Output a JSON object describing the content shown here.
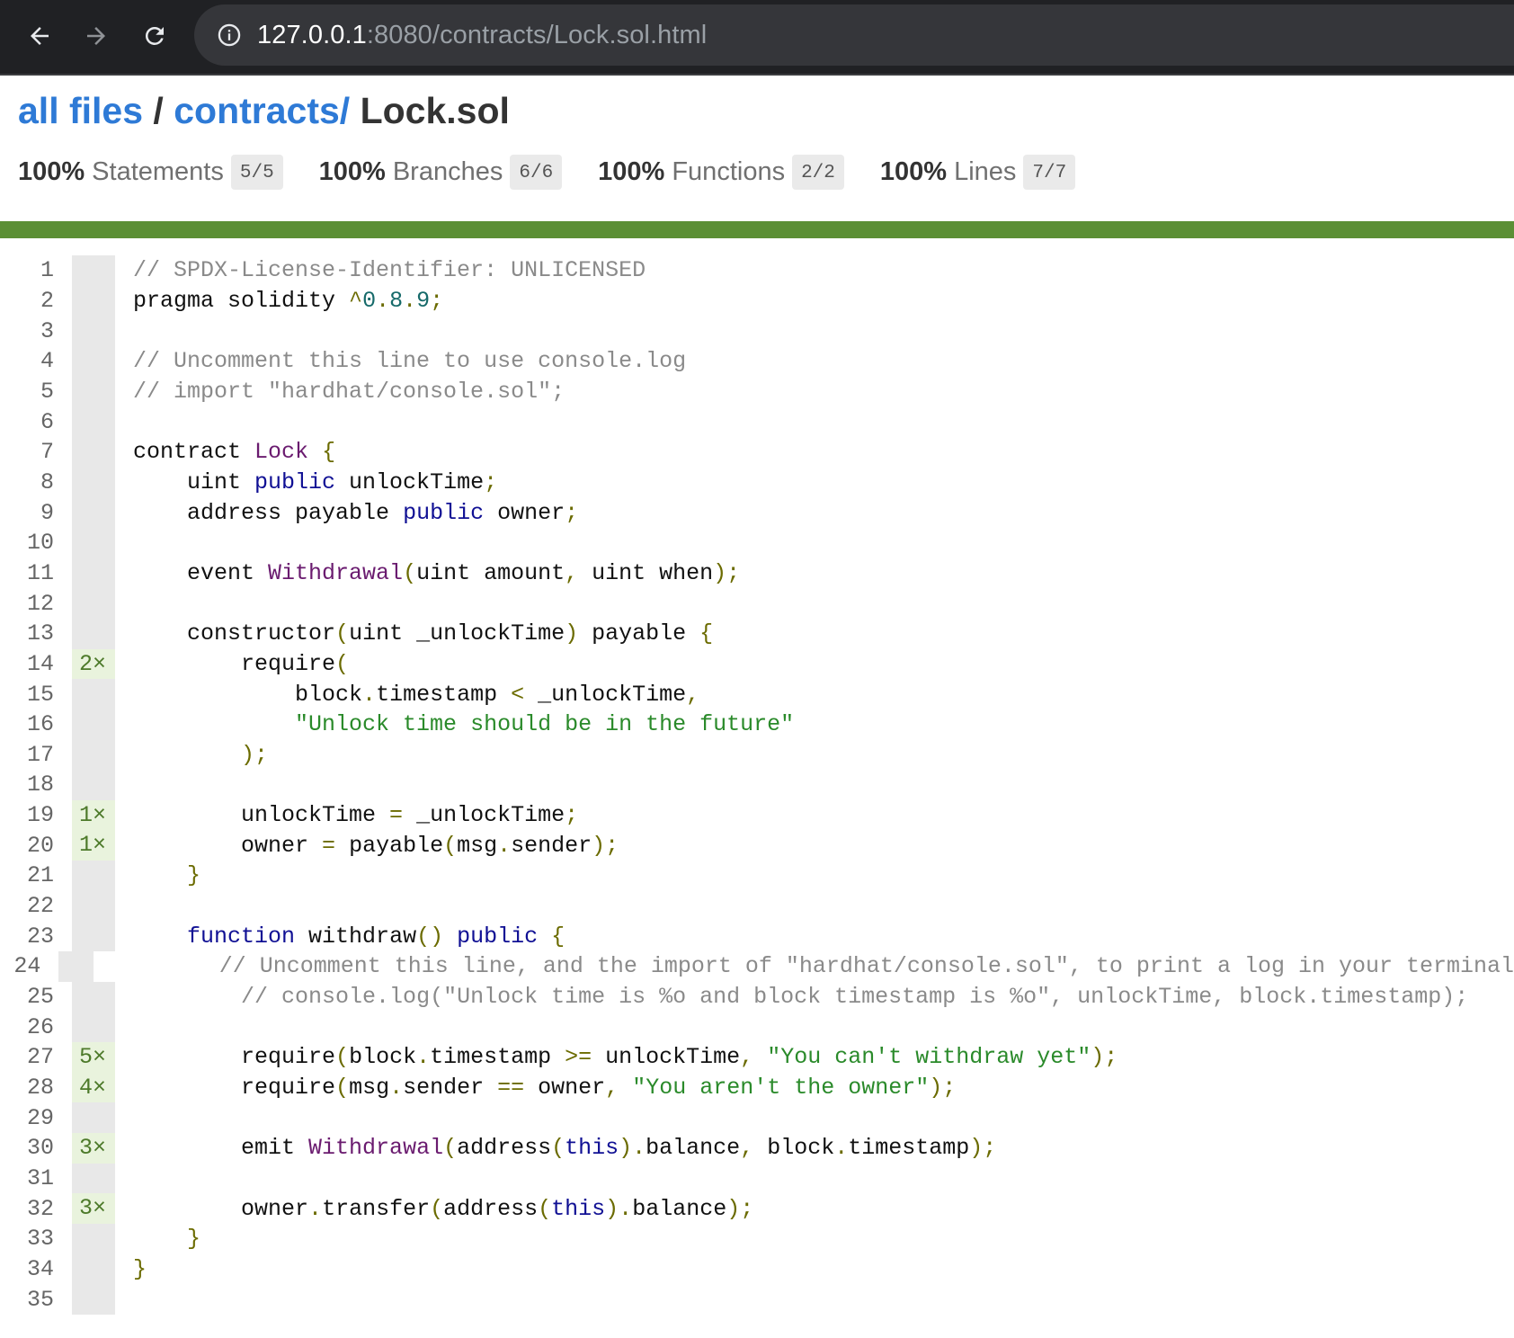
{
  "browser": {
    "url_host": "127.0.0.1",
    "url_rest": ":8080/contracts/Lock.sol.html"
  },
  "breadcrumb": {
    "root_link": "all files",
    "separator": "/",
    "dir_link": "contracts/",
    "file": "Lock.sol"
  },
  "summary": [
    {
      "pct": "100%",
      "label": "Statements",
      "fraction": "5/5"
    },
    {
      "pct": "100%",
      "label": "Branches",
      "fraction": "6/6"
    },
    {
      "pct": "100%",
      "label": "Functions",
      "fraction": "2/2"
    },
    {
      "pct": "100%",
      "label": "Lines",
      "fraction": "7/7"
    }
  ],
  "colors": {
    "status_bar": "#5b8f35",
    "link": "#2e7ad6",
    "covered_gutter": "#e9f3dd"
  },
  "lines": [
    {
      "n": "1",
      "hits": "",
      "tokens": [
        [
          "com",
          "// SPDX-License-Identifier: UNLICENSED"
        ]
      ]
    },
    {
      "n": "2",
      "hits": "",
      "tokens": [
        [
          "",
          "pragma solidity "
        ],
        [
          "pun",
          "^"
        ],
        [
          "num",
          "0"
        ],
        [
          "pun",
          "."
        ],
        [
          "num",
          "8"
        ],
        [
          "pun",
          "."
        ],
        [
          "num",
          "9"
        ],
        [
          "pun",
          ";"
        ]
      ]
    },
    {
      "n": "3",
      "hits": "",
      "tokens": []
    },
    {
      "n": "4",
      "hits": "",
      "tokens": [
        [
          "com",
          "// Uncomment this line to use console.log"
        ]
      ]
    },
    {
      "n": "5",
      "hits": "",
      "tokens": [
        [
          "com",
          "// import \"hardhat/console.sol\";"
        ]
      ]
    },
    {
      "n": "6",
      "hits": "",
      "tokens": []
    },
    {
      "n": "7",
      "hits": "",
      "tokens": [
        [
          "",
          "contract "
        ],
        [
          "typ",
          "Lock"
        ],
        [
          "",
          " "
        ],
        [
          "pun",
          "{"
        ]
      ]
    },
    {
      "n": "8",
      "hits": "",
      "tokens": [
        [
          "",
          "    uint "
        ],
        [
          "kw",
          "public"
        ],
        [
          "",
          " unlockTime"
        ],
        [
          "pun",
          ";"
        ]
      ]
    },
    {
      "n": "9",
      "hits": "",
      "tokens": [
        [
          "",
          "    address payable "
        ],
        [
          "kw",
          "public"
        ],
        [
          "",
          " owner"
        ],
        [
          "pun",
          ";"
        ]
      ]
    },
    {
      "n": "10",
      "hits": "",
      "tokens": []
    },
    {
      "n": "11",
      "hits": "",
      "tokens": [
        [
          "",
          "    event "
        ],
        [
          "typ",
          "Withdrawal"
        ],
        [
          "pun",
          "("
        ],
        [
          "",
          "uint amount"
        ],
        [
          "pun",
          ","
        ],
        [
          "",
          " uint when"
        ],
        [
          "pun",
          ");"
        ]
      ]
    },
    {
      "n": "12",
      "hits": "",
      "tokens": []
    },
    {
      "n": "13",
      "hits": "",
      "tokens": [
        [
          "",
          "    constructor"
        ],
        [
          "pun",
          "("
        ],
        [
          "",
          "uint _unlockTime"
        ],
        [
          "pun",
          ")"
        ],
        [
          "",
          " payable "
        ],
        [
          "pun",
          "{"
        ]
      ]
    },
    {
      "n": "14",
      "hits": "2×",
      "tokens": [
        [
          "",
          "        require"
        ],
        [
          "pun",
          "("
        ]
      ]
    },
    {
      "n": "15",
      "hits": "",
      "tokens": [
        [
          "",
          "            block"
        ],
        [
          "pun",
          "."
        ],
        [
          "",
          "timestamp "
        ],
        [
          "pun",
          "<"
        ],
        [
          "",
          " _unlockTime"
        ],
        [
          "pun",
          ","
        ]
      ]
    },
    {
      "n": "16",
      "hits": "",
      "tokens": [
        [
          "",
          "            "
        ],
        [
          "str",
          "\"Unlock time should be in the future\""
        ]
      ]
    },
    {
      "n": "17",
      "hits": "",
      "tokens": [
        [
          "",
          "        "
        ],
        [
          "pun",
          ");"
        ]
      ]
    },
    {
      "n": "18",
      "hits": "",
      "tokens": []
    },
    {
      "n": "19",
      "hits": "1×",
      "tokens": [
        [
          "",
          "        unlockTime "
        ],
        [
          "pun",
          "="
        ],
        [
          "",
          " _unlockTime"
        ],
        [
          "pun",
          ";"
        ]
      ]
    },
    {
      "n": "20",
      "hits": "1×",
      "tokens": [
        [
          "",
          "        owner "
        ],
        [
          "pun",
          "="
        ],
        [
          "",
          " payable"
        ],
        [
          "pun",
          "("
        ],
        [
          "",
          "msg"
        ],
        [
          "pun",
          "."
        ],
        [
          "",
          "sender"
        ],
        [
          "pun",
          ");"
        ]
      ]
    },
    {
      "n": "21",
      "hits": "",
      "tokens": [
        [
          "",
          "    "
        ],
        [
          "pun",
          "}"
        ]
      ]
    },
    {
      "n": "22",
      "hits": "",
      "tokens": []
    },
    {
      "n": "23",
      "hits": "",
      "tokens": [
        [
          "",
          "    "
        ],
        [
          "kw",
          "function"
        ],
        [
          "",
          " withdraw"
        ],
        [
          "pun",
          "()"
        ],
        [
          "",
          " "
        ],
        [
          "kw",
          "public"
        ],
        [
          "",
          " "
        ],
        [
          "pun",
          "{"
        ]
      ]
    },
    {
      "n": "24",
      "hits": "",
      "tokens": [
        [
          "",
          "        "
        ],
        [
          "com",
          "// Uncomment this line, and the import of \"hardhat/console.sol\", to print a log in your terminal"
        ]
      ]
    },
    {
      "n": "25",
      "hits": "",
      "tokens": [
        [
          "",
          "        "
        ],
        [
          "com",
          "// console.log(\"Unlock time is %o and block timestamp is %o\", unlockTime, block.timestamp);"
        ]
      ]
    },
    {
      "n": "26",
      "hits": "",
      "tokens": []
    },
    {
      "n": "27",
      "hits": "5×",
      "tokens": [
        [
          "",
          "        require"
        ],
        [
          "pun",
          "("
        ],
        [
          "",
          "block"
        ],
        [
          "pun",
          "."
        ],
        [
          "",
          "timestamp "
        ],
        [
          "pun",
          ">="
        ],
        [
          "",
          " unlockTime"
        ],
        [
          "pun",
          ","
        ],
        [
          "",
          " "
        ],
        [
          "str",
          "\"You can't withdraw yet\""
        ],
        [
          "pun",
          ");"
        ]
      ]
    },
    {
      "n": "28",
      "hits": "4×",
      "tokens": [
        [
          "",
          "        require"
        ],
        [
          "pun",
          "("
        ],
        [
          "",
          "msg"
        ],
        [
          "pun",
          "."
        ],
        [
          "",
          "sender "
        ],
        [
          "pun",
          "=="
        ],
        [
          "",
          " owner"
        ],
        [
          "pun",
          ","
        ],
        [
          "",
          " "
        ],
        [
          "str",
          "\"You aren't the owner\""
        ],
        [
          "pun",
          ");"
        ]
      ]
    },
    {
      "n": "29",
      "hits": "",
      "tokens": []
    },
    {
      "n": "30",
      "hits": "3×",
      "tokens": [
        [
          "",
          "        emit "
        ],
        [
          "typ",
          "Withdrawal"
        ],
        [
          "pun",
          "("
        ],
        [
          "",
          "address"
        ],
        [
          "pun",
          "("
        ],
        [
          "kw",
          "this"
        ],
        [
          "pun",
          ")."
        ],
        [
          "",
          "balance"
        ],
        [
          "pun",
          ","
        ],
        [
          "",
          " block"
        ],
        [
          "pun",
          "."
        ],
        [
          "",
          "timestamp"
        ],
        [
          "pun",
          ");"
        ]
      ]
    },
    {
      "n": "31",
      "hits": "",
      "tokens": []
    },
    {
      "n": "32",
      "hits": "3×",
      "tokens": [
        [
          "",
          "        owner"
        ],
        [
          "pun",
          "."
        ],
        [
          "",
          "transfer"
        ],
        [
          "pun",
          "("
        ],
        [
          "",
          "address"
        ],
        [
          "pun",
          "("
        ],
        [
          "kw",
          "this"
        ],
        [
          "pun",
          ")."
        ],
        [
          "",
          "balance"
        ],
        [
          "pun",
          ");"
        ]
      ]
    },
    {
      "n": "33",
      "hits": "",
      "tokens": [
        [
          "",
          "    "
        ],
        [
          "pun",
          "}"
        ]
      ]
    },
    {
      "n": "34",
      "hits": "",
      "tokens": [
        [
          "pun",
          "}"
        ]
      ]
    },
    {
      "n": "35",
      "hits": "",
      "tokens": []
    }
  ]
}
